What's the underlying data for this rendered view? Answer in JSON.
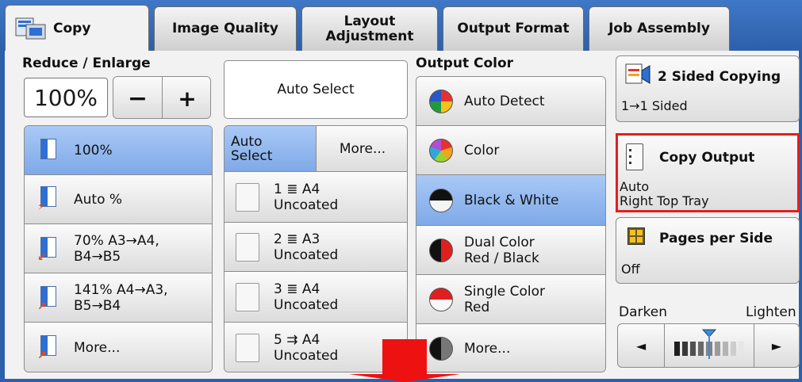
{
  "tabs": [
    {
      "label": "Copy"
    },
    {
      "label": "Image Quality"
    },
    {
      "label": "Layout\nAdjustment"
    },
    {
      "label": "Output Format"
    },
    {
      "label": "Job Assembly"
    }
  ],
  "reduce_enlarge": {
    "title": "Reduce / Enlarge",
    "value": "100%",
    "minus": "−",
    "plus": "+",
    "presets": [
      {
        "label": "100%"
      },
      {
        "label": "Auto %"
      },
      {
        "label": "70% A3→A4,\nB4→B5"
      },
      {
        "label": "141% A4→A3,\nB5→B4"
      },
      {
        "label": "More..."
      }
    ]
  },
  "paper": {
    "auto_select_button": "Auto Select",
    "tab_auto_select": "Auto\nSelect",
    "tab_more": "More...",
    "trays": [
      {
        "line1": "1 ≣ A4",
        "line2": "Uncoated"
      },
      {
        "line1": "2 ≣ A3",
        "line2": "Uncoated"
      },
      {
        "line1": "3 ≣ A4",
        "line2": "Uncoated"
      },
      {
        "line1": "5 ⇉ A4",
        "line2": "Uncoated"
      }
    ]
  },
  "output_color": {
    "title": "Output Color",
    "options": [
      {
        "label": "Auto Detect"
      },
      {
        "label": "Color"
      },
      {
        "label": "Black & White"
      },
      {
        "label": "Dual Color\nRed / Black"
      },
      {
        "label": "Single Color\nRed"
      },
      {
        "label": "More..."
      }
    ]
  },
  "right_panel": {
    "two_sided": {
      "title": "2 Sided Copying",
      "value": "1→1 Sided"
    },
    "copy_output": {
      "title": "Copy Output",
      "value_line1": "Auto",
      "value_line2": "Right Top Tray"
    },
    "pages_per_side": {
      "title": "Pages per Side",
      "value": "Off"
    },
    "darken_label": "Darken",
    "lighten_label": "Lighten",
    "left_arrow": "◄",
    "right_arrow": "►",
    "density_level": 0.5
  },
  "colors": {
    "tab_bar": "#2d5faa",
    "selected": "#7fa9e8",
    "highlight_border": "#e02020",
    "annotation_arrow": "#ee1111"
  }
}
